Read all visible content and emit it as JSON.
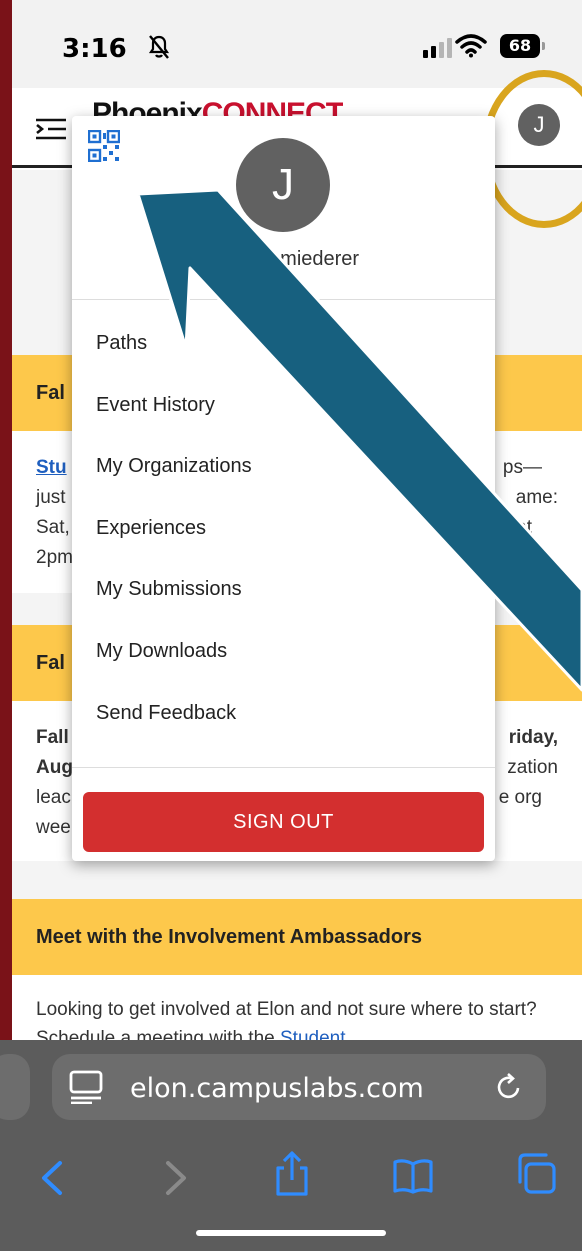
{
  "status_bar": {
    "time": "3:16",
    "battery": "68"
  },
  "header": {
    "brand_prefix": "Phoenix",
    "brand_accent": "CONNECT",
    "avatar_initial": "J"
  },
  "dropdown": {
    "avatar_initial": "J",
    "name": "Jen Schmiederer",
    "items": [
      {
        "label": "Paths"
      },
      {
        "label": "Event History"
      },
      {
        "label": "My Organizations"
      },
      {
        "label": "Experiences"
      },
      {
        "label": "My Submissions"
      },
      {
        "label": "My Downloads"
      },
      {
        "label": "Send Feedback"
      }
    ],
    "sign_out": "SIGN OUT"
  },
  "cards": {
    "fall1": {
      "title_fragment": "Fal",
      "body_l1_link": "Stu",
      "body_l1_right": "ps—",
      "body_l2_left": "just",
      "body_l2_right": "ame:",
      "body_l3_left": "Sat,",
      "body_l3_right": "s at",
      "body_l4_left": "2pm"
    },
    "fall2": {
      "title_fragment": "Fal",
      "body_l1_left": "Fall",
      "body_l1_right": "riday,",
      "body_l2_left": "Aug",
      "body_l2_right": "zation",
      "body_l3_left": "leac",
      "body_l3_right": "e org",
      "body_l4_left": "wee"
    },
    "ambassadors": {
      "title": "Meet with the Involvement Ambassadors",
      "body": "Looking to get involved at Elon and not sure where to start? Schedule a meeting with the ",
      "body_link": "Student"
    }
  },
  "browser": {
    "url": "elon.campuslabs.com"
  },
  "colors": {
    "maroon": "#7a1218",
    "gold": "#fdc84b",
    "ring": "#d9a51e",
    "arrow": "#17607f",
    "signout": "#d32f2f",
    "link": "#1f5fbf"
  }
}
